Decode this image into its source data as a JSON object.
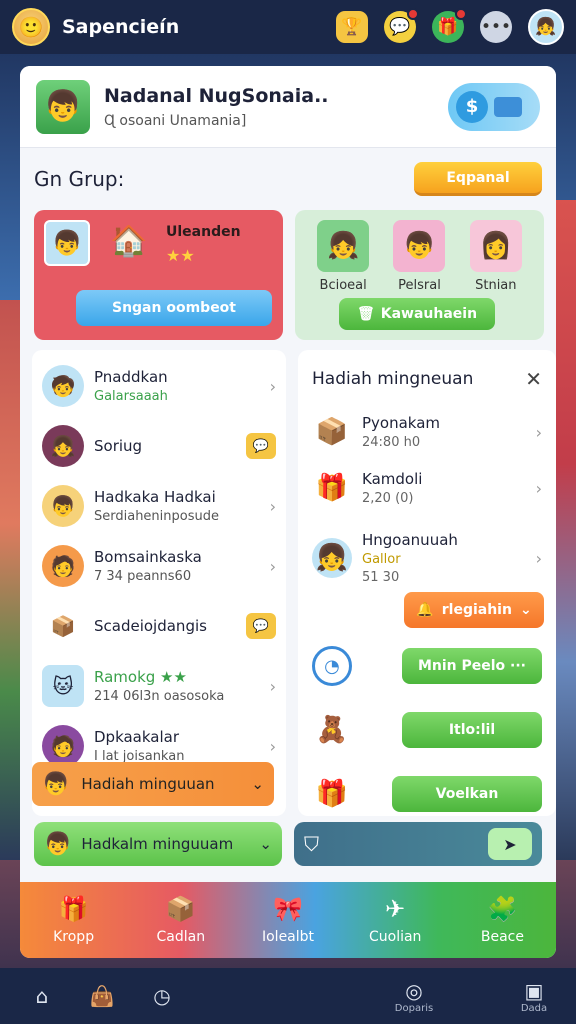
{
  "topbar": {
    "title": "Sapencieín",
    "avatar_icon": "player-avatar",
    "icons": [
      "trophy-icon",
      "chat-icon",
      "gift-icon",
      "more-icon",
      "profile-icon"
    ]
  },
  "profile": {
    "name": "Nadanal NugSonaia..",
    "subtitle": "Ɋ osoani Unamania]",
    "currency_symbol": "$"
  },
  "group": {
    "title": "Gn Grup:",
    "button_label": "Eqpanal"
  },
  "card_red": {
    "label": "Uleanden",
    "stars": "★★",
    "button_label": "Sngan oombeot"
  },
  "card_green": {
    "friends": [
      {
        "name": "Bcioeal"
      },
      {
        "name": "Pelsral"
      },
      {
        "name": "Stnian"
      }
    ],
    "button_label": "Kawauhaein"
  },
  "left_list": {
    "items": [
      {
        "title": "Pnaddkan",
        "sub": "Galarsaaah",
        "has_chevron": true
      },
      {
        "title": "Soriug",
        "sub": "",
        "has_badge": true
      },
      {
        "title": "Hadkaka Hadkai",
        "sub": "Serdiaheninposude",
        "has_chevron": true
      },
      {
        "title": "Bomsainkaska",
        "sub": "7 34 peanns60",
        "has_chevron": true
      },
      {
        "title": "Scadeiojdangis",
        "sub": "",
        "has_badge": true
      },
      {
        "title": "Ramokg ★★",
        "sub": "214 06l3n oasosoka",
        "has_chevron": true
      },
      {
        "title": "Dpkaakalar",
        "sub": "I lat joisankan",
        "has_chevron": true
      }
    ],
    "bottom_label": "Hadiah minguuan"
  },
  "right_list": {
    "title": "Hadiah mingneuan",
    "items": [
      {
        "title": "Pyonakam",
        "sub": "24:80 h0"
      },
      {
        "title": "Kamdoli",
        "sub": "2,20 (0)"
      },
      {
        "title": "Hngoanuuah",
        "sub": "Gallor"
      }
    ],
    "extra_sub": "51 30",
    "pills": [
      "rlegiahin",
      "Mnin Peelo ···",
      "Itlo:lil",
      "Voelkan"
    ]
  },
  "bottom_row": {
    "left_label": "Hadkalm minguuam"
  },
  "tabs": [
    {
      "label": "Kropp",
      "icon": "gift-box-icon"
    },
    {
      "label": "Cadlan",
      "icon": "crate-icon"
    },
    {
      "label": "Iolealbt",
      "icon": "present-icon"
    },
    {
      "label": "Cuolian",
      "icon": "plane-icon"
    },
    {
      "label": "Beace",
      "icon": "puzzle-icon"
    }
  ],
  "navbar": [
    {
      "label": "",
      "icon": "home-icon"
    },
    {
      "label": "",
      "icon": "bag-icon"
    },
    {
      "label": "",
      "icon": "clock-icon"
    },
    {
      "label": "Doparis",
      "icon": "target-icon"
    },
    {
      "label": "Dada",
      "icon": "message-icon"
    }
  ]
}
